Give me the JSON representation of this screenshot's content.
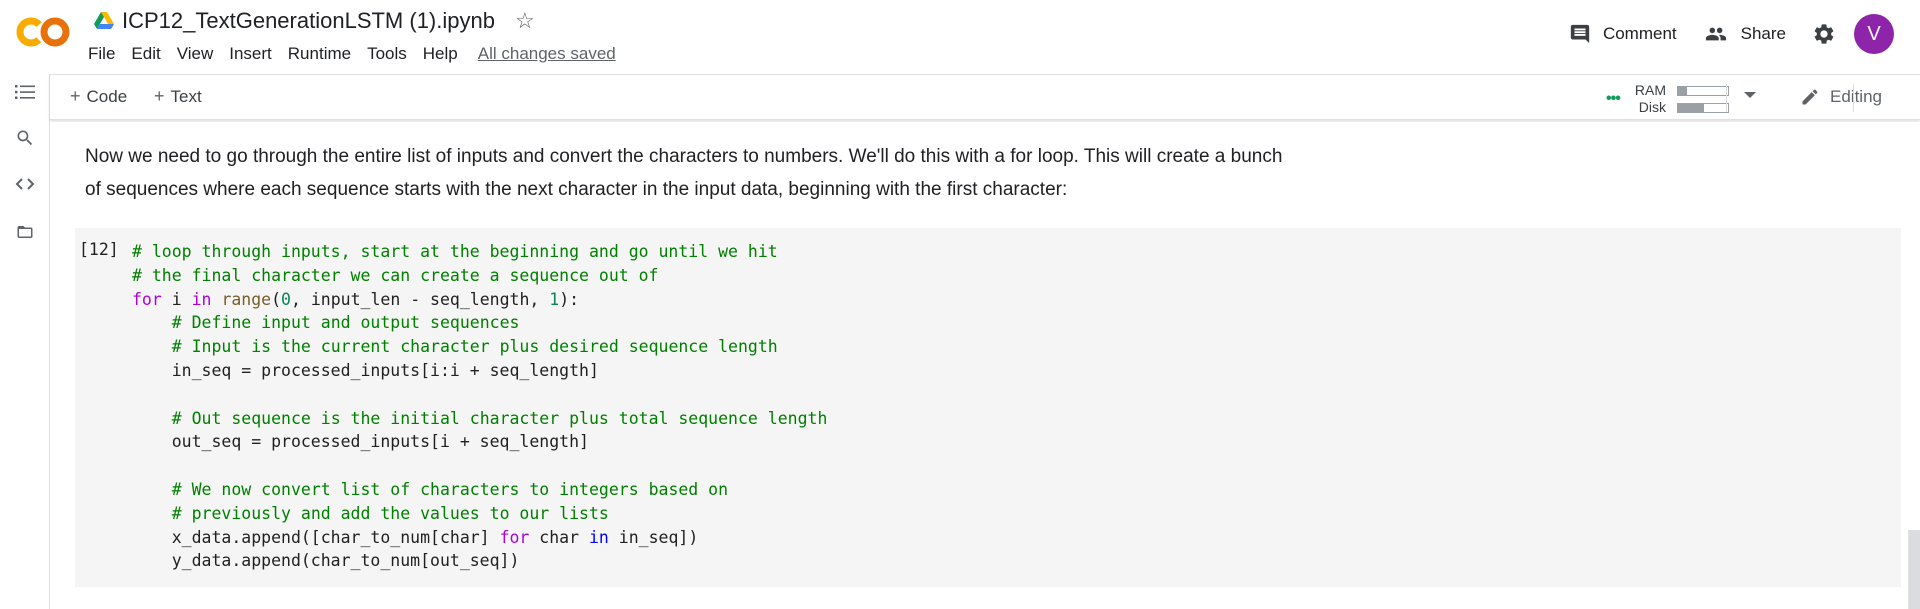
{
  "header": {
    "title": "ICP12_TextGenerationLSTM (1).ipynb",
    "menu": [
      "File",
      "Edit",
      "View",
      "Insert",
      "Runtime",
      "Tools",
      "Help"
    ],
    "save_status": "All changes saved",
    "comment_label": "Comment",
    "share_label": "Share",
    "avatar_letter": "V",
    "avatar_color": "#8e24aa",
    "logo_colors": [
      "#f9ab00",
      "#e8710a"
    ]
  },
  "sidebar": {
    "icons": [
      "table-of-contents-icon",
      "search-icon",
      "code-snippets-icon",
      "files-folder-icon"
    ]
  },
  "toolbar": {
    "add_code_label": "Code",
    "add_text_label": "Text",
    "ram_label": "RAM",
    "disk_label": "Disk",
    "ram_usage": 0.18,
    "disk_usage": 0.52,
    "mode_label": "Editing",
    "status_color": "#0f9d58"
  },
  "notebook": {
    "text_cell": {
      "lines": [
        "Now we need to go through the entire list of inputs and convert the characters to numbers. We'll do this with a for loop. This will create a bunch",
        "of sequences where each sequence starts with the next character in the input data, beginning with the first character:"
      ]
    },
    "code_cell": {
      "execution_count": "[12]",
      "lines": [
        [
          [
            "c",
            "# loop through inputs, start at the beginning and go until we hit"
          ]
        ],
        [
          [
            "c",
            "# the final character we can create a sequence out of"
          ]
        ],
        [
          [
            "k",
            "for"
          ],
          [
            "p",
            " i "
          ],
          [
            "k",
            "in"
          ],
          [
            "p",
            " "
          ],
          [
            "b",
            "range"
          ],
          [
            "p",
            "("
          ],
          [
            "n",
            "0"
          ],
          [
            "p",
            ", input_len - seq_length, "
          ],
          [
            "n",
            "1"
          ],
          [
            "p",
            "):"
          ]
        ],
        [
          [
            "p",
            "    "
          ],
          [
            "c",
            "# Define input and output sequences"
          ]
        ],
        [
          [
            "p",
            "    "
          ],
          [
            "c",
            "# Input is the current character plus desired sequence length"
          ]
        ],
        [
          [
            "p",
            "    in_seq = processed_inputs[i:i + seq_length]"
          ]
        ],
        [
          [
            "p",
            ""
          ]
        ],
        [
          [
            "p",
            "    "
          ],
          [
            "c",
            "# Out sequence is the initial character plus total sequence length"
          ]
        ],
        [
          [
            "p",
            "    out_seq = processed_inputs[i + seq_length]"
          ]
        ],
        [
          [
            "p",
            ""
          ]
        ],
        [
          [
            "p",
            "    "
          ],
          [
            "c",
            "# We now convert list of characters to integers based on"
          ]
        ],
        [
          [
            "p",
            "    "
          ],
          [
            "c",
            "# previously and add the values to our lists"
          ]
        ],
        [
          [
            "p",
            "    x_data.append([char_to_num[char] "
          ],
          [
            "k",
            "for"
          ],
          [
            "p",
            " char "
          ],
          [
            "kb",
            "in"
          ],
          [
            "p",
            " in_seq])"
          ]
        ],
        [
          [
            "p",
            "    y_data.append(char_to_num[out_seq])"
          ]
        ]
      ]
    }
  }
}
